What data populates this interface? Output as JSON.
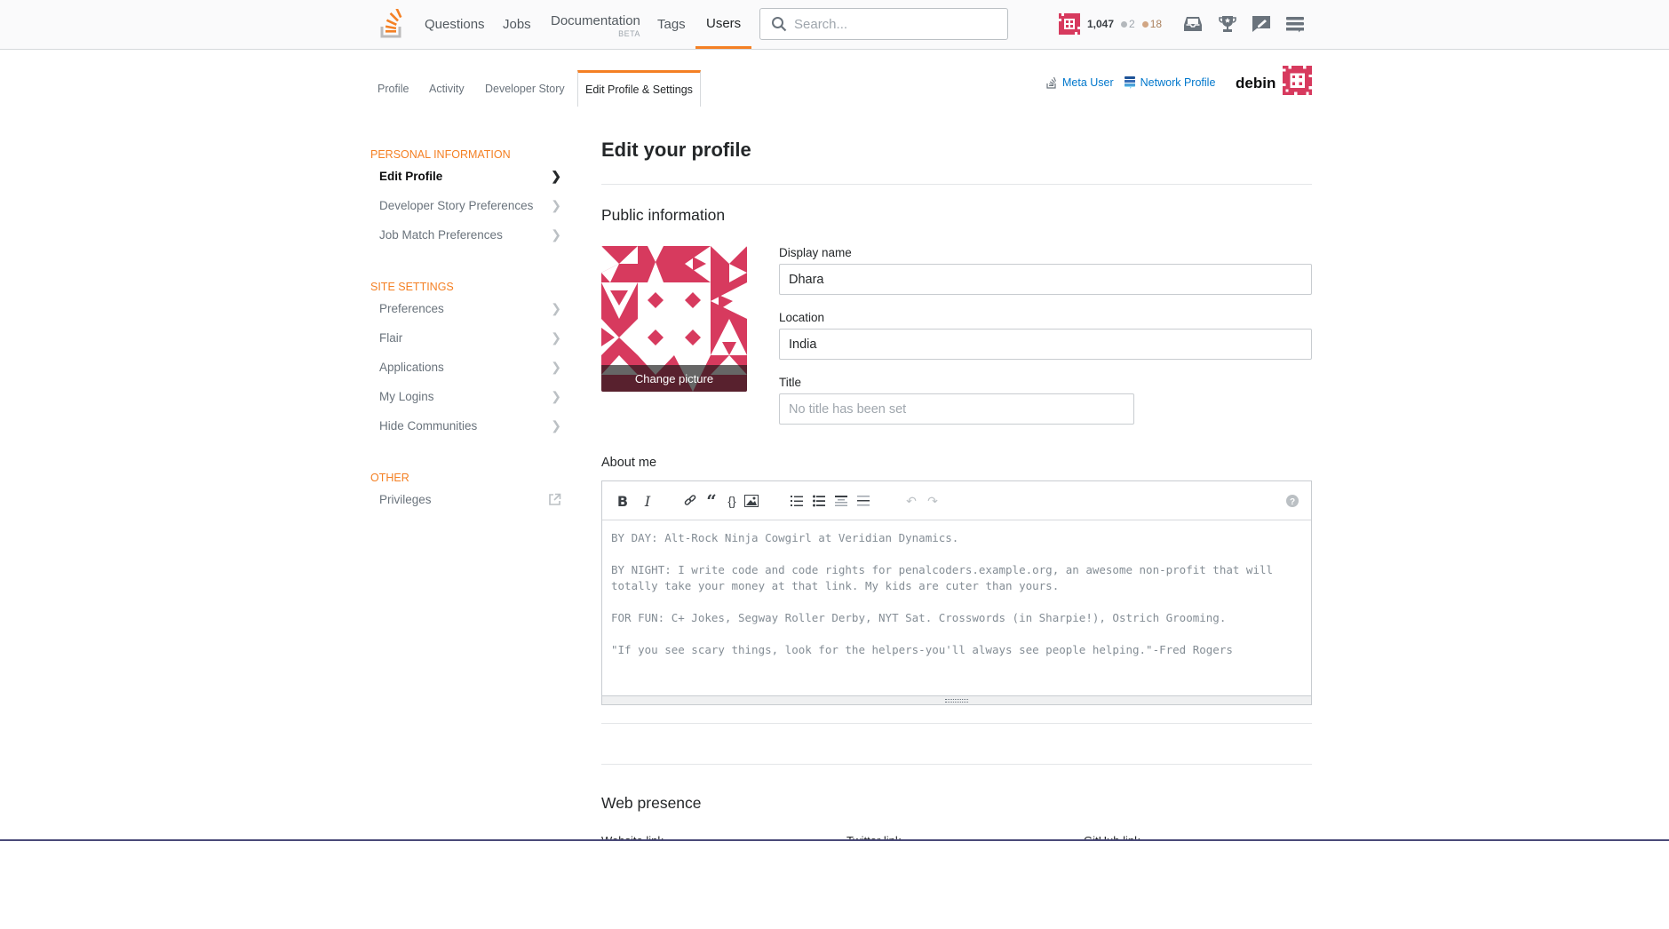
{
  "topbar": {
    "nav": [
      {
        "label": "Questions"
      },
      {
        "label": "Jobs"
      },
      {
        "label": "Documentation",
        "sublabel": "BETA"
      },
      {
        "label": "Tags"
      },
      {
        "label": "Users",
        "active": true
      }
    ],
    "search_placeholder": "Search...",
    "reputation": "1,047",
    "silver_badges": "2",
    "bronze_badges": "18",
    "colors": {
      "accent": "#f48024",
      "silver": "#b4b8bc",
      "bronze": "#d1a684",
      "identicon": "#d73a5e"
    },
    "icons": [
      "inbox-icon",
      "achievements-icon",
      "review-icon",
      "site-switcher-icon"
    ]
  },
  "profile_tabs": {
    "tabs": [
      {
        "label": "Profile"
      },
      {
        "label": "Activity"
      },
      {
        "label": "Developer Story"
      },
      {
        "label": "Edit Profile & Settings",
        "active": true
      }
    ],
    "meta_user_label": "Meta User",
    "network_profile_label": "Network Profile",
    "username": "debin"
  },
  "sidebar": {
    "sections": [
      {
        "title": "PERSONAL INFORMATION",
        "items": [
          {
            "label": "Edit Profile",
            "active": true
          },
          {
            "label": "Developer Story Preferences"
          },
          {
            "label": "Job Match Preferences"
          }
        ]
      },
      {
        "title": "SITE SETTINGS",
        "items": [
          {
            "label": "Preferences"
          },
          {
            "label": "Flair"
          },
          {
            "label": "Applications"
          },
          {
            "label": "My Logins"
          },
          {
            "label": "Hide Communities"
          }
        ]
      },
      {
        "title": "OTHER",
        "items": [
          {
            "label": "Privileges",
            "external": true
          }
        ]
      }
    ]
  },
  "main": {
    "title": "Edit your profile",
    "public_info_heading": "Public information",
    "change_picture_label": "Change picture",
    "display_name_label": "Display name",
    "display_name_value": "Dhara",
    "location_label": "Location",
    "location_value": "India",
    "title_label": "Title",
    "title_value": "",
    "title_placeholder": "No title has been set",
    "about_label": "About me",
    "about_value": "BY DAY: Alt-Rock Ninja Cowgirl at Veridian Dynamics.\n\nBY NIGHT: I write code and code rights for penalcoders.example.org, an awesome non-profit that will totally take your money at that link. My kids are cuter than yours.\n\nFOR FUN: C+ Jokes, Segway Roller Derby, NYT Sat. Crosswords (in Sharpie!), Ostrich Grooming.\n\n\"If you see scary things, look for the helpers-you'll always see people helping.\"-Fred Rogers",
    "editor_toolbar": [
      "bold",
      "italic",
      "link",
      "blockquote",
      "code",
      "image",
      "ordered-list",
      "bulleted-list",
      "heading",
      "horizontal-rule",
      "undo",
      "redo",
      "help"
    ],
    "web_presence_heading": "Web presence",
    "web_presence_columns": [
      "Website link",
      "Twitter link",
      "GitHub link"
    ]
  }
}
